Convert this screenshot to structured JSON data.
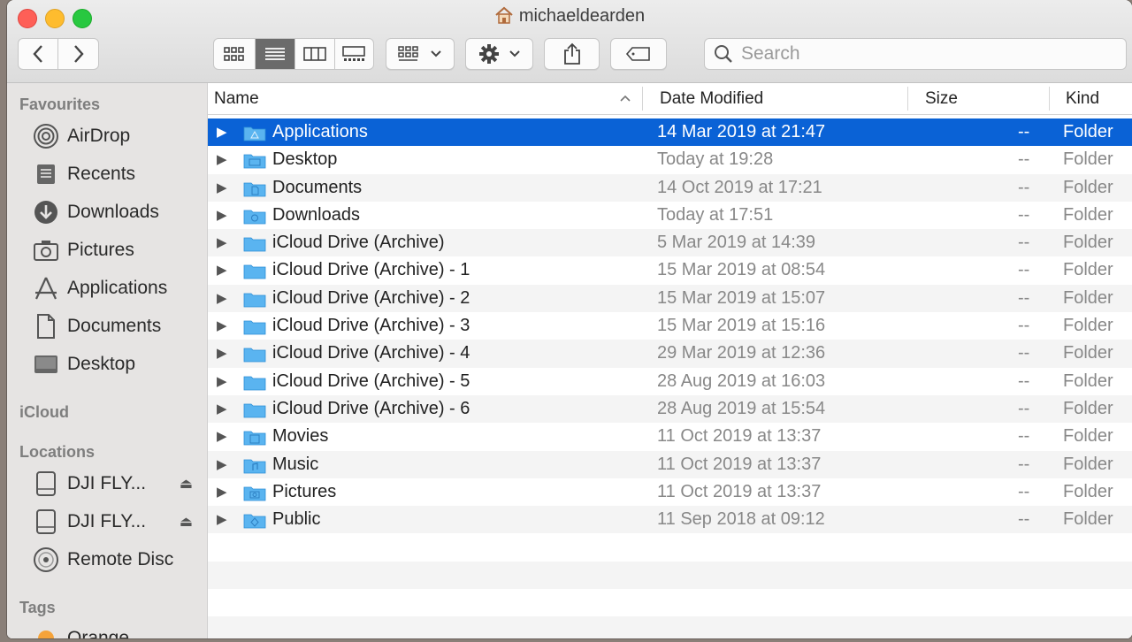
{
  "window": {
    "title": "michaeldearden"
  },
  "toolbar": {
    "search_placeholder": "Search",
    "icons": [
      "chevron-left-icon",
      "chevron-right-icon",
      "icon-view-icon",
      "list-view-icon",
      "column-view-icon",
      "gallery-view-icon",
      "group-icon",
      "gear-icon",
      "share-icon",
      "tag-icon",
      "search-icon"
    ]
  },
  "sidebar": {
    "favourites_heading": "Favourites",
    "favourites": [
      {
        "label": "AirDrop",
        "icon": "airdrop-icon"
      },
      {
        "label": "Recents",
        "icon": "recents-icon"
      },
      {
        "label": "Downloads",
        "icon": "downloads-icon"
      },
      {
        "label": "Pictures",
        "icon": "camera-icon"
      },
      {
        "label": "Applications",
        "icon": "applications-icon"
      },
      {
        "label": "Documents",
        "icon": "document-icon"
      },
      {
        "label": "Desktop",
        "icon": "desktop-icon"
      }
    ],
    "icloud_heading": "iCloud",
    "locations_heading": "Locations",
    "locations": [
      {
        "label": "DJI FLY...",
        "icon": "drive-icon",
        "eject": "⏏"
      },
      {
        "label": "DJI FLY...",
        "icon": "drive-icon",
        "eject": "⏏"
      },
      {
        "label": "Remote Disc",
        "icon": "disc-icon"
      }
    ],
    "tags_heading": "Tags",
    "tags": [
      {
        "label": "Orange",
        "color": "#f5a33a"
      }
    ]
  },
  "list": {
    "columns": {
      "name": "Name",
      "date": "Date Modified",
      "size": "Size",
      "kind": "Kind"
    },
    "rows": [
      {
        "name": "Applications",
        "date": "14 Mar 2019 at 21:47",
        "size": "--",
        "kind": "Folder",
        "selected": true
      },
      {
        "name": "Desktop",
        "date": "Today at 19:28",
        "size": "--",
        "kind": "Folder"
      },
      {
        "name": "Documents",
        "date": "14 Oct 2019 at 17:21",
        "size": "--",
        "kind": "Folder"
      },
      {
        "name": "Downloads",
        "date": "Today at 17:51",
        "size": "--",
        "kind": "Folder"
      },
      {
        "name": "iCloud Drive (Archive)",
        "date": "5 Mar 2019 at 14:39",
        "size": "--",
        "kind": "Folder"
      },
      {
        "name": "iCloud Drive (Archive) - 1",
        "date": "15 Mar 2019 at 08:54",
        "size": "--",
        "kind": "Folder"
      },
      {
        "name": "iCloud Drive (Archive) - 2",
        "date": "15 Mar 2019 at 15:07",
        "size": "--",
        "kind": "Folder"
      },
      {
        "name": "iCloud Drive (Archive) - 3",
        "date": "15 Mar 2019 at 15:16",
        "size": "--",
        "kind": "Folder"
      },
      {
        "name": "iCloud Drive (Archive) - 4",
        "date": "29 Mar 2019 at 12:36",
        "size": "--",
        "kind": "Folder"
      },
      {
        "name": "iCloud Drive (Archive) - 5",
        "date": "28 Aug 2019 at 16:03",
        "size": "--",
        "kind": "Folder"
      },
      {
        "name": "iCloud Drive (Archive) - 6",
        "date": "28 Aug 2019 at 15:54",
        "size": "--",
        "kind": "Folder"
      },
      {
        "name": "Movies",
        "date": "11 Oct 2019 at 13:37",
        "size": "--",
        "kind": "Folder"
      },
      {
        "name": "Music",
        "date": "11 Oct 2019 at 13:37",
        "size": "--",
        "kind": "Folder"
      },
      {
        "name": "Pictures",
        "date": "11 Oct 2019 at 13:37",
        "size": "--",
        "kind": "Folder"
      },
      {
        "name": "Public",
        "date": "11 Sep 2018 at 09:12",
        "size": "--",
        "kind": "Folder"
      }
    ]
  },
  "colors": {
    "selection": "#0a62d6",
    "folder": "#5ab4f0"
  }
}
